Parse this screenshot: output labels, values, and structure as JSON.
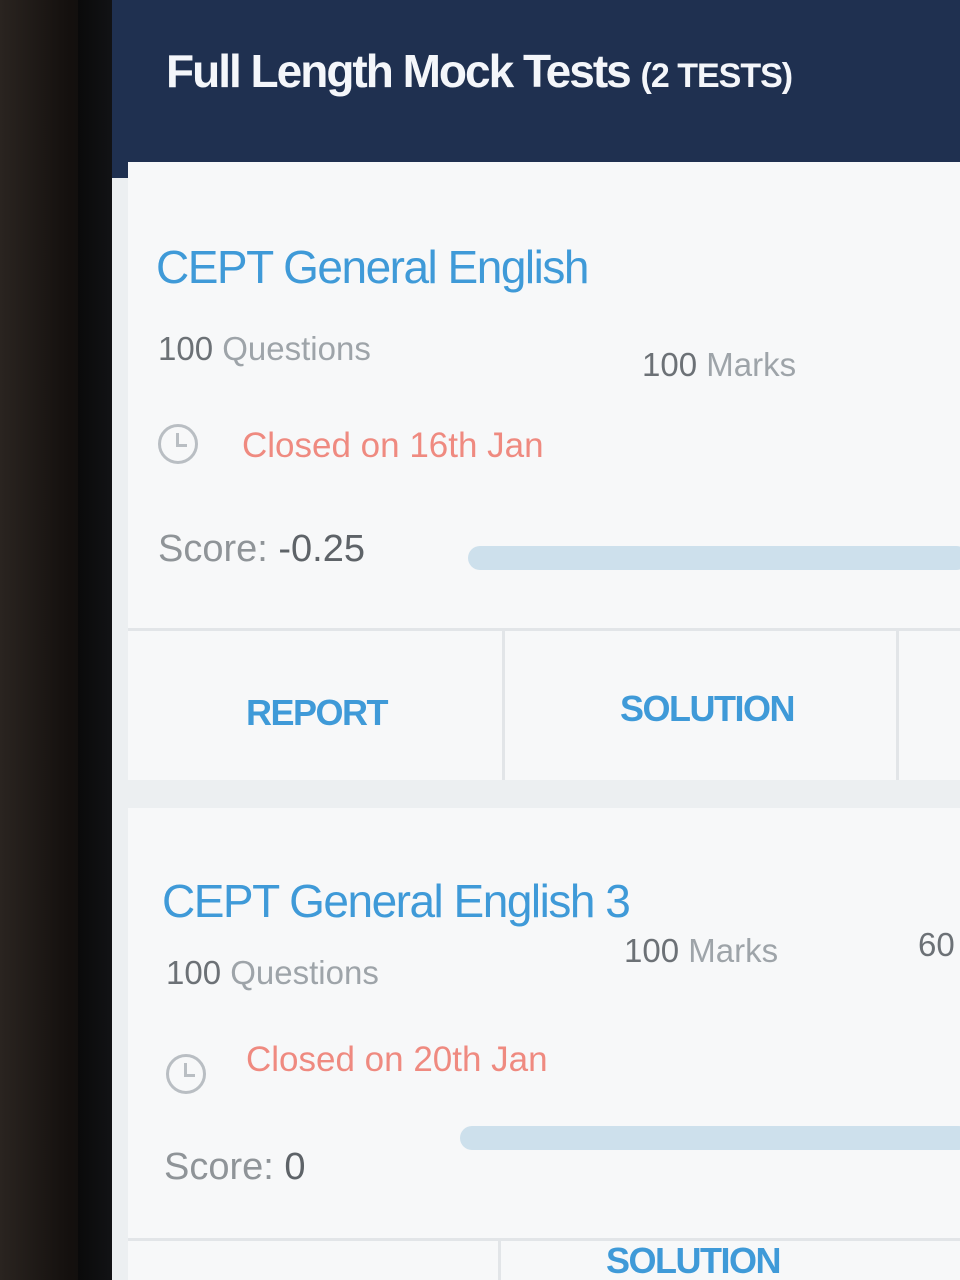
{
  "header": {
    "title": "Full Length Mock Tests",
    "count": "(2 TESTS)"
  },
  "tests": [
    {
      "title": "CEPT General English",
      "questions_num": "100",
      "questions_label": "Questions",
      "marks_num": "100",
      "marks_label": "Marks",
      "status": "Closed on 16th Jan",
      "score_label": "Score:",
      "score_value": "-0.25",
      "progress_fraction": 0,
      "actions": [
        "REPORT",
        "SOLUTION"
      ]
    },
    {
      "title": "CEPT General English 3",
      "questions_num": "100",
      "questions_label": "Questions",
      "marks_num": "100",
      "marks_label": "Marks",
      "extra_partial": "60",
      "status": "Closed on 20th Jan",
      "score_label": "Score:",
      "score_value": "0",
      "progress_fraction": 0,
      "actions": [
        "SOLUTION"
      ]
    }
  ],
  "colors": {
    "header_bg": "#1f3050",
    "title_blue": "#3f9ad8",
    "closed_red": "#ef8a80",
    "progress_track": "#cde0ec"
  }
}
